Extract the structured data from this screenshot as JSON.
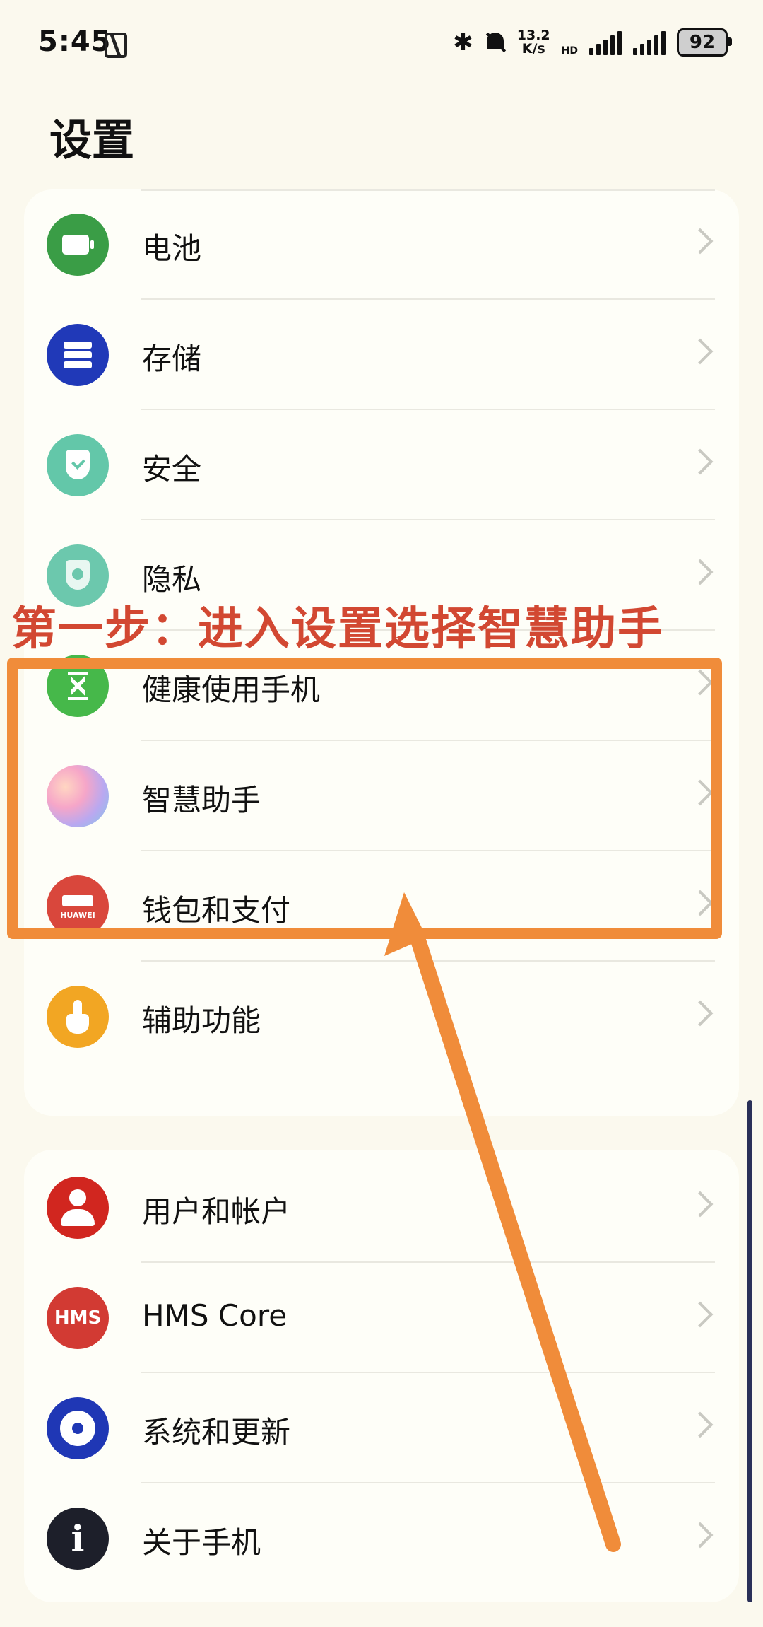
{
  "status_bar": {
    "time": "5:45",
    "net_speed_value": "13.2",
    "net_speed_unit": "K/s",
    "hd_label": "HD",
    "battery": "92"
  },
  "page": {
    "title": "设置"
  },
  "group1": [
    {
      "label": "电池",
      "icon": "battery-icon"
    },
    {
      "label": "存储",
      "icon": "storage-icon"
    },
    {
      "label": "安全",
      "icon": "shield-check-icon"
    },
    {
      "label": "隐私",
      "icon": "privacy-shield-icon"
    },
    {
      "label": "健康使用手机",
      "icon": "hourglass-icon"
    },
    {
      "label": "智慧助手",
      "icon": "smart-assistant-icon"
    },
    {
      "label": "钱包和支付",
      "icon": "huawei-wallet-icon"
    },
    {
      "label": "辅助功能",
      "icon": "hand-touch-icon"
    }
  ],
  "group2": [
    {
      "label": "用户和帐户",
      "icon": "user-icon"
    },
    {
      "label": "HMS Core",
      "icon": "hms-core-icon",
      "icon_text": "HMS"
    },
    {
      "label": "系统和更新",
      "icon": "gear-icon"
    },
    {
      "label": "关于手机",
      "icon": "info-icon",
      "icon_text": "i"
    }
  ],
  "annotation": {
    "text": "第一步：进入设置选择智慧助手",
    "color": "#d24832",
    "box_color": "#f08c3a"
  }
}
